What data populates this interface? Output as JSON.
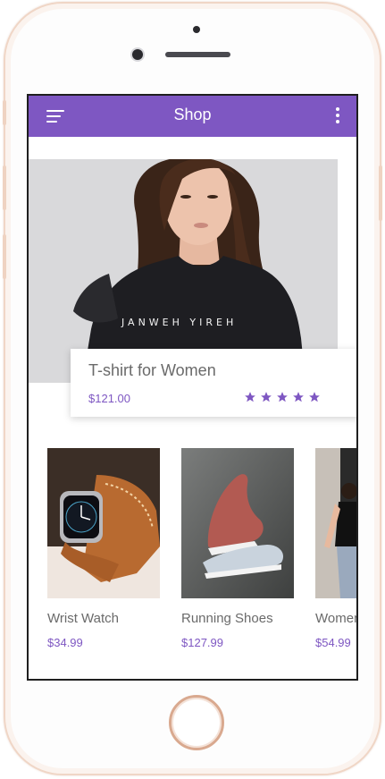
{
  "app": {
    "title": "Shop",
    "accent_color": "#7e57c2",
    "menu_icon": "menu-icon",
    "more_icon": "more-vertical-icon"
  },
  "featured": {
    "title": "T-shirt for Women",
    "price": "$121.00",
    "rating": 5,
    "rating_max": 5,
    "shirt_print": "JANWEH YIREH"
  },
  "products": [
    {
      "name": "Wrist Watch",
      "price": "$34.99",
      "image": "wrist-watch"
    },
    {
      "name": "Running Shoes",
      "price": "$127.99",
      "image": "running-shoes"
    },
    {
      "name": "Women",
      "price": "$54.99",
      "image": "women-apparel"
    }
  ]
}
